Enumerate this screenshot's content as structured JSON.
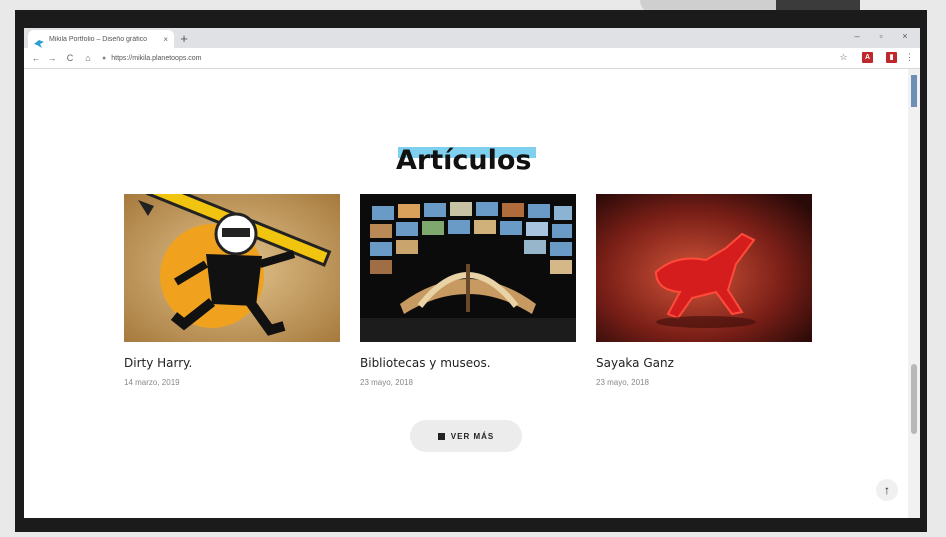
{
  "browser": {
    "tab_title": "Mikila Portfolio – Diseño gráfico",
    "tab_close": "×",
    "new_tab": "+",
    "win_min": "–",
    "win_max": "▫",
    "win_close": "×",
    "back": "←",
    "forward": "→",
    "reload": "C",
    "home": "⌂",
    "url": "https://mikila.planetoops.com",
    "lock": "●",
    "star": "☆",
    "ext_pdf": "A",
    "ext_other": "▮",
    "menu": "⋮"
  },
  "page": {
    "section_title": "Artículos",
    "articles": [
      {
        "title": "Dirty Harry.",
        "date": "14 marzo, 2019"
      },
      {
        "title": "Bibliotecas y museos.",
        "date": "23 mayo, 2018"
      },
      {
        "title": "Sayaka Ganz",
        "date": "23 mayo, 2018"
      }
    ],
    "more_button": "VER MÁS",
    "to_top": "↑"
  },
  "colors": {
    "title_highlight": "#7fd0ee",
    "frame": "#1b1b1b"
  }
}
